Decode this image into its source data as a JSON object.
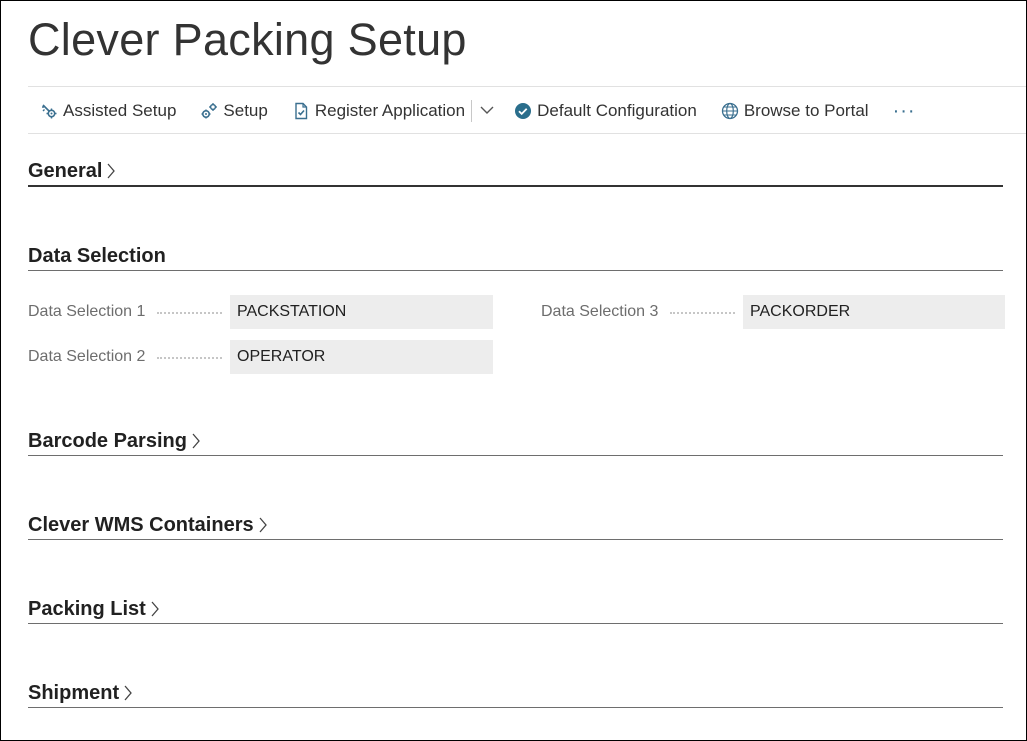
{
  "page": {
    "title": "Clever Packing Setup"
  },
  "actions": {
    "assisted_setup": "Assisted Setup",
    "setup": "Setup",
    "register_application": "Register Application",
    "default_configuration": "Default Configuration",
    "browse_to_portal": "Browse to Portal",
    "more": "···"
  },
  "icons": {
    "assisted_setup": "assisted-setup-icon",
    "setup": "setup-gears-icon",
    "register_application": "document-check-icon",
    "default_configuration": "check-circle-icon",
    "browse_to_portal": "globe-icon",
    "split_dropdown": "chevron-down-icon",
    "section_expand": "chevron-right-icon"
  },
  "colors": {
    "accent": "#3a6f8f",
    "check_circle": "#2a6e8c",
    "field_bg": "#ededed",
    "label": "#6d6d6d"
  },
  "sections": {
    "general": "General",
    "data_selection": "Data Selection",
    "barcode_parsing": "Barcode Parsing",
    "clever_wms_containers": "Clever WMS Containers",
    "packing_list": "Packing List",
    "shipment": "Shipment"
  },
  "data_selection": {
    "field1": {
      "label": "Data Selection 1",
      "value": "PACKSTATION"
    },
    "field2": {
      "label": "Data Selection 2",
      "value": "OPERATOR"
    },
    "field3": {
      "label": "Data Selection 3",
      "value": "PACKORDER"
    }
  }
}
